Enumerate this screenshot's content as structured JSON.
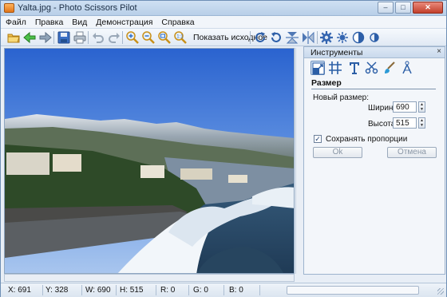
{
  "window": {
    "title": "Yalta.jpg - Photo Scissors Pilot",
    "controls": {
      "minimize": "–",
      "maximize": "□",
      "close": "✕"
    }
  },
  "menu": [
    "Файл",
    "Правка",
    "Вид",
    "Демонстрация",
    "Справка"
  ],
  "toolbar": {
    "show_original": "Показать исходное",
    "icons": [
      "open-folder",
      "back-arrow",
      "forward-arrow",
      "save",
      "print",
      "undo",
      "redo",
      "zoom-in",
      "zoom-out",
      "zoom-fit",
      "zoom-actual",
      "rotate-right",
      "rotate-left",
      "flip-vertical",
      "flip-horizontal",
      "settings",
      "brightness",
      "contrast",
      "saturation"
    ]
  },
  "tools_panel": {
    "title": "Инструменты",
    "close": "×",
    "tool_icons": [
      "resize",
      "crop-grid",
      "text",
      "scissors",
      "brush",
      "compass"
    ],
    "section_title": "Размер",
    "new_size_label": "Новый размер:",
    "width_label": "Ширина:",
    "width_value": "690",
    "height_label": "Высота:",
    "height_value": "515",
    "keep_proportions_label": "Сохранять пропорции",
    "keep_proportions_checked": true,
    "ok_label": "Ok",
    "cancel_label": "Отмена"
  },
  "statusbar": {
    "x": "X: 691",
    "y": "Y: 328",
    "w": "W: 690",
    "h": "H: 515",
    "r": "R: 0",
    "g": "G: 0",
    "b": "B: 0"
  },
  "colors": {
    "accent": "#6e8fb5",
    "panel_bg": "#f3f6fa",
    "sky_top": "#2f6fd8",
    "sea": "#2b4a66"
  }
}
